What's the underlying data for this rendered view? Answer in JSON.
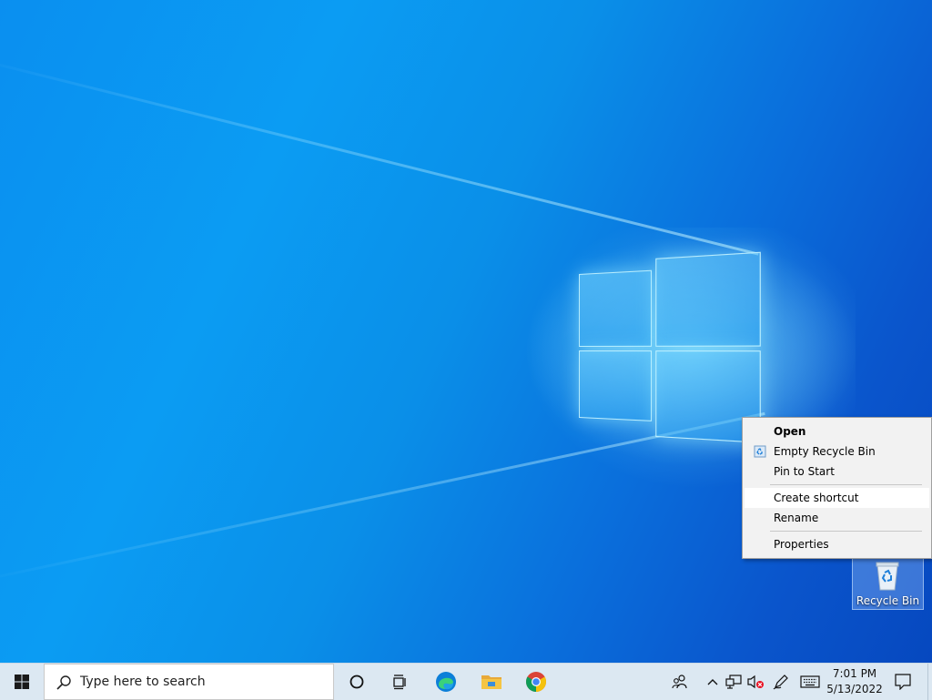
{
  "desktop": {
    "icons": [
      {
        "label": "Recycle Bin"
      }
    ]
  },
  "context_menu": {
    "items": [
      {
        "label": "Open"
      },
      {
        "label": "Empty Recycle Bin"
      },
      {
        "label": "Pin to Start"
      },
      {
        "label": "Create shortcut"
      },
      {
        "label": "Rename"
      },
      {
        "label": "Properties"
      }
    ]
  },
  "taskbar": {
    "search_placeholder": "Type here to search",
    "clock": {
      "time": "7:01 PM",
      "date": "5/13/2022"
    },
    "pinned": [
      "task-view",
      "edge",
      "file-explorer",
      "chrome"
    ],
    "colors": {
      "accent": "#0a78d7",
      "taskbar_bg": "#dce8f2",
      "wallpaper": "#0b8ff0"
    }
  }
}
